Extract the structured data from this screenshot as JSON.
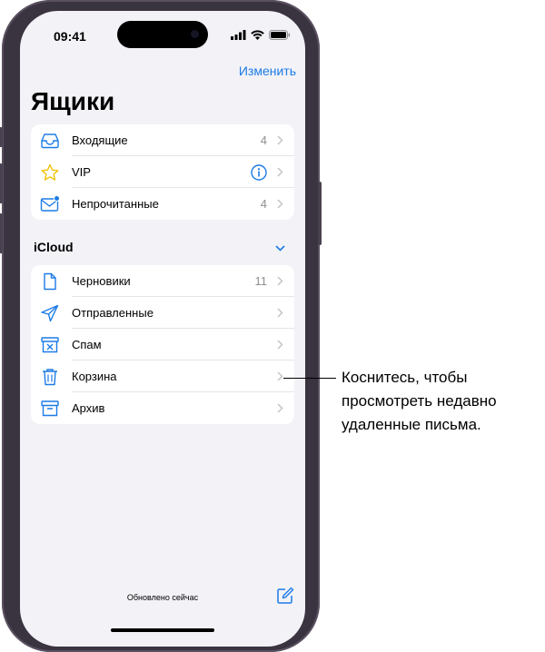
{
  "status_bar": {
    "time": "09:41"
  },
  "nav": {
    "edit_label": "Изменить"
  },
  "title": "Ящики",
  "favorites": [
    {
      "label": "Входящие",
      "count": "4",
      "icon": "inbox-icon"
    },
    {
      "label": "VIP",
      "count": "",
      "icon": "star-icon"
    },
    {
      "label": "Непрочитанные",
      "count": "4",
      "icon": "unread-envelope-icon"
    }
  ],
  "icloud": {
    "section_label": "iCloud",
    "items": [
      {
        "label": "Черновики",
        "count": "11",
        "icon": "draft-document-icon"
      },
      {
        "label": "Отправленные",
        "count": "",
        "icon": "paper-plane-icon"
      },
      {
        "label": "Спам",
        "count": "",
        "icon": "junk-box-icon"
      },
      {
        "label": "Корзина",
        "count": "",
        "icon": "trash-icon"
      },
      {
        "label": "Архив",
        "count": "",
        "icon": "archive-box-icon"
      }
    ]
  },
  "footer": {
    "status": "Обновлено сейчас"
  },
  "callout": {
    "text": "Коснитесь, чтобы\nпросмотреть недавно\nудаленные письма."
  },
  "colors": {
    "accent": "#1c7be6",
    "background": "#f2f2f7",
    "frame": "#3a3340"
  }
}
